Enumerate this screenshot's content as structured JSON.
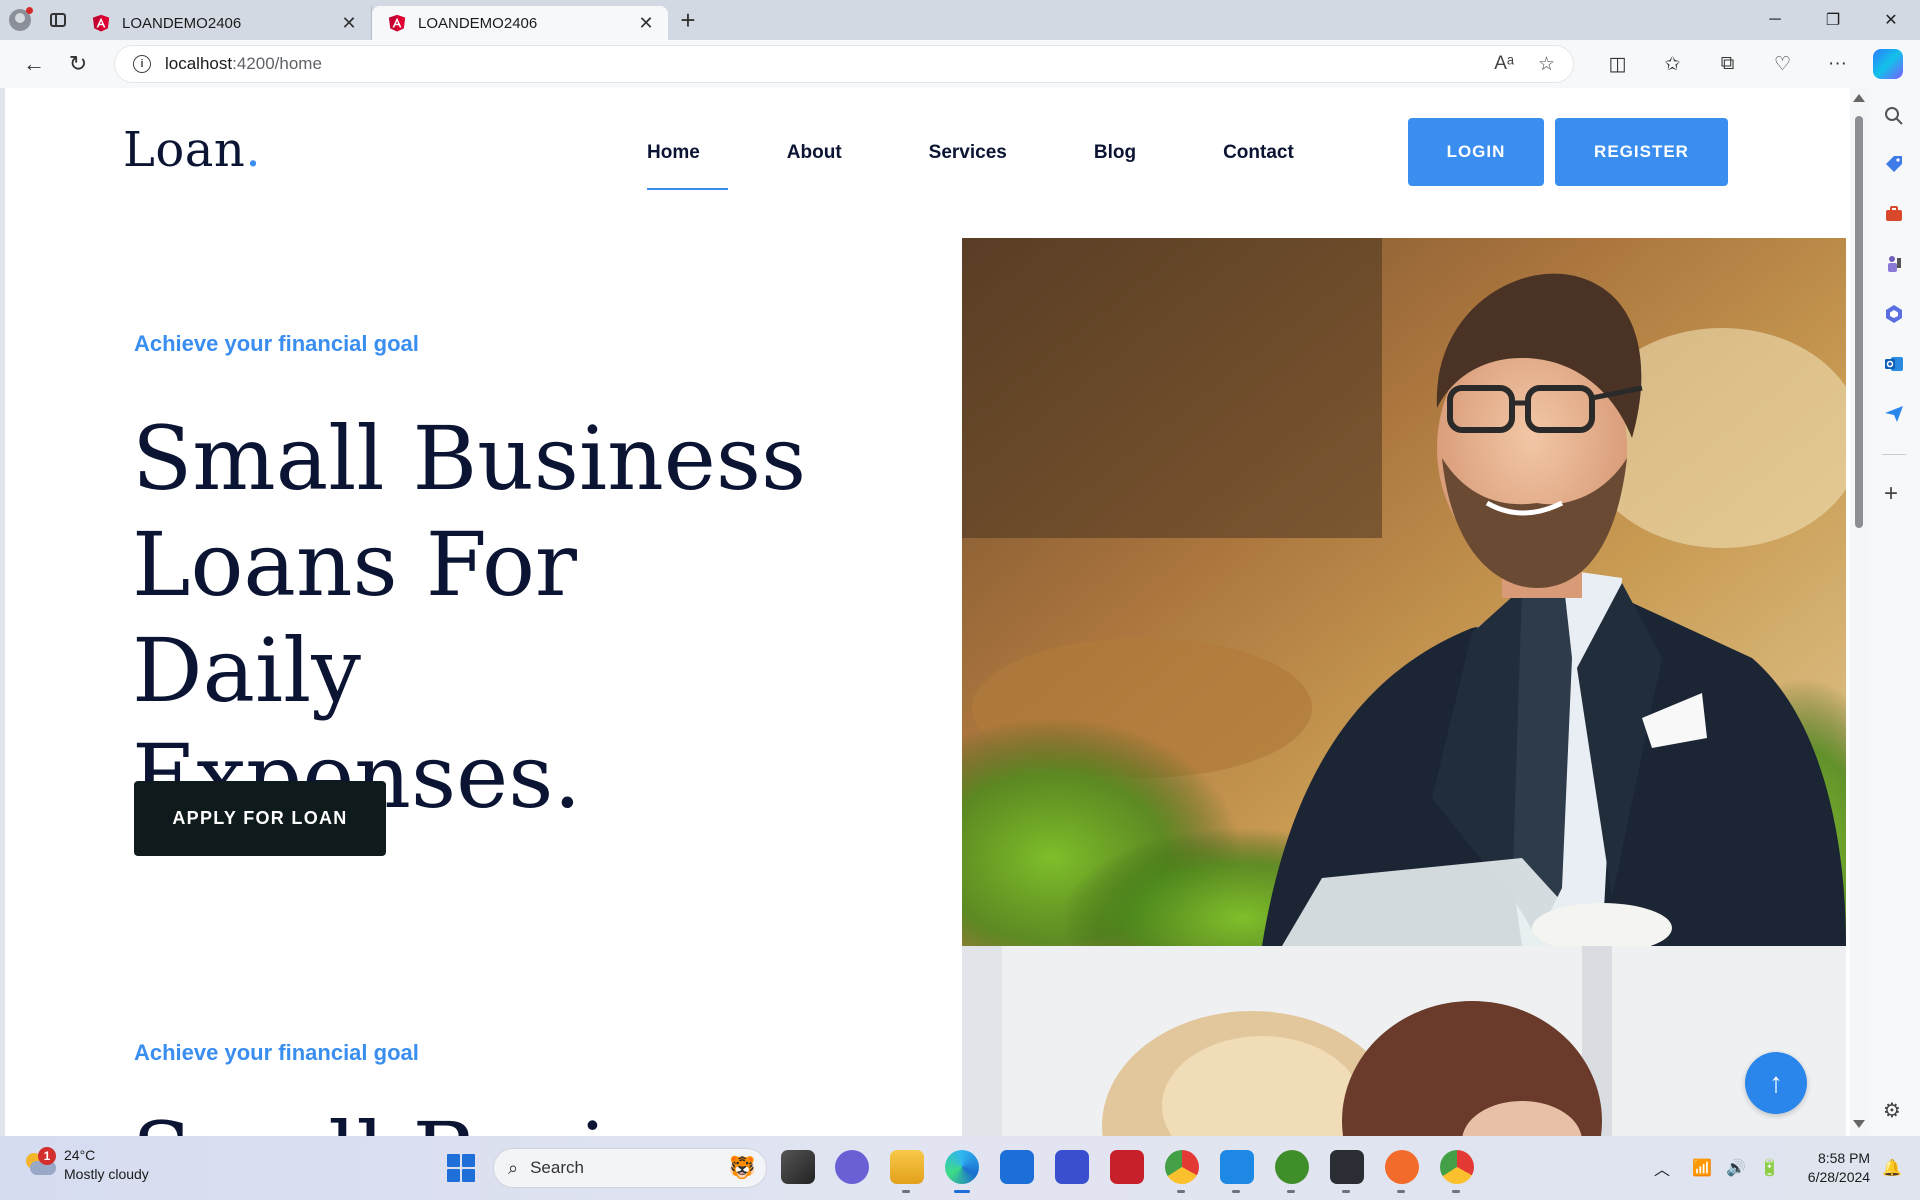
{
  "browser": {
    "tabs": [
      {
        "title": "LOANDEMO2406",
        "active": false
      },
      {
        "title": "LOANDEMO2406",
        "active": true
      }
    ],
    "url_host": "localhost",
    "url_rest": ":4200/home"
  },
  "site": {
    "logo": "Loan",
    "logo_dot": ".",
    "nav": [
      "Home",
      "About",
      "Services",
      "Blog",
      "Contact"
    ],
    "active_nav": "Home",
    "login_label": "LOGIN",
    "register_label": "REGISTER"
  },
  "hero": {
    "kicker": "Achieve your financial goal",
    "title_lines": [
      "Small Business",
      "Loans For Daily",
      "Expenses."
    ],
    "apply_label": "APPLY FOR LOAN",
    "next_kicker": "Achieve your financial goal",
    "next_title_partial": "Small Busi"
  },
  "taskbar": {
    "weather_temp": "24°C",
    "weather_desc": "Mostly cloudy",
    "weather_badge": "1",
    "search_placeholder": "Search",
    "time": "8:58 PM",
    "date": "6/28/2024"
  },
  "colors": {
    "accent": "#3a8ef0",
    "navy": "#0b1533",
    "dark_button": "#0f1a1c"
  }
}
